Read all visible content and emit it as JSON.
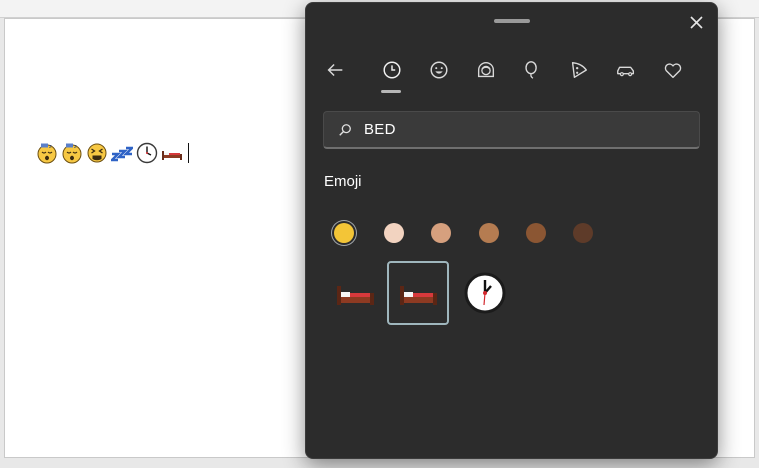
{
  "document": {
    "typed_emojis": [
      "sleeping-face-icon",
      "sleeping-face-icon",
      "tired-face-icon",
      "zzz-icon",
      "clock-icon",
      "bed-icon"
    ]
  },
  "picker": {
    "tabs": [
      {
        "name": "back-arrow-icon",
        "label": ""
      },
      {
        "name": "recent-clock-icon",
        "label": ""
      },
      {
        "name": "smiley-icon",
        "label": ""
      },
      {
        "name": "person-icon",
        "label": ""
      },
      {
        "name": "balloon-icon",
        "label": ""
      },
      {
        "name": "pizza-icon",
        "label": ""
      },
      {
        "name": "car-icon",
        "label": ""
      },
      {
        "name": "heart-icon",
        "label": ""
      }
    ],
    "active_tab": "recent-clock-icon",
    "search": {
      "value": "BED"
    },
    "section_title": "Emoji",
    "skin_tones": [
      "#f3c537",
      "#f2d3c0",
      "#d6a07e",
      "#b57c51",
      "#8b5633",
      "#5e3b29"
    ],
    "selected_skin_tone": 0,
    "results": [
      "bed-icon",
      "bed-icon",
      "one-oclock-icon"
    ],
    "focused_result": 1,
    "colors": {
      "accent": "#9fb6bd",
      "panel": "#2c2c2c",
      "field": "#3a3a3a"
    }
  }
}
